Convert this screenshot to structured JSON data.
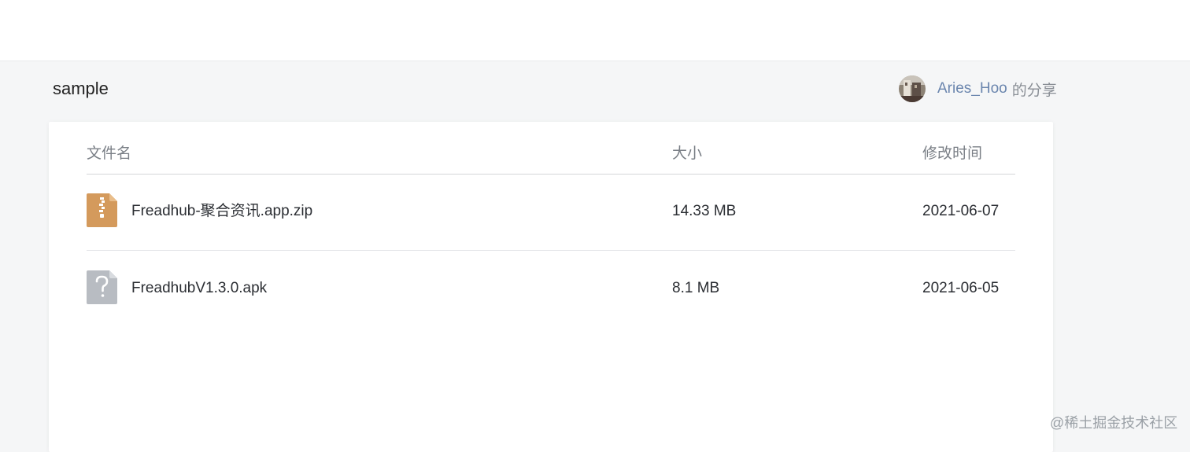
{
  "folder_title": "sample",
  "share": {
    "user": "Aries_Hoo",
    "suffix": "的分享"
  },
  "table": {
    "headers": {
      "name": "文件名",
      "size": "大小",
      "modified": "修改时间"
    },
    "rows": [
      {
        "icon": "zip-file-icon",
        "name": "Freadhub-聚合资讯.app.zip",
        "size": "14.33 MB",
        "modified": "2021-06-07"
      },
      {
        "icon": "unknown-file-icon",
        "name": "FreadhubV1.3.0.apk",
        "size": "8.1 MB",
        "modified": "2021-06-05"
      }
    ]
  },
  "watermark": "@稀土掘金技术社区",
  "colors": {
    "page_background": "#f5f6f7",
    "link": "#6b86ae",
    "zip_icon": "#d49a5c",
    "unknown_icon": "#b8bcc2"
  }
}
